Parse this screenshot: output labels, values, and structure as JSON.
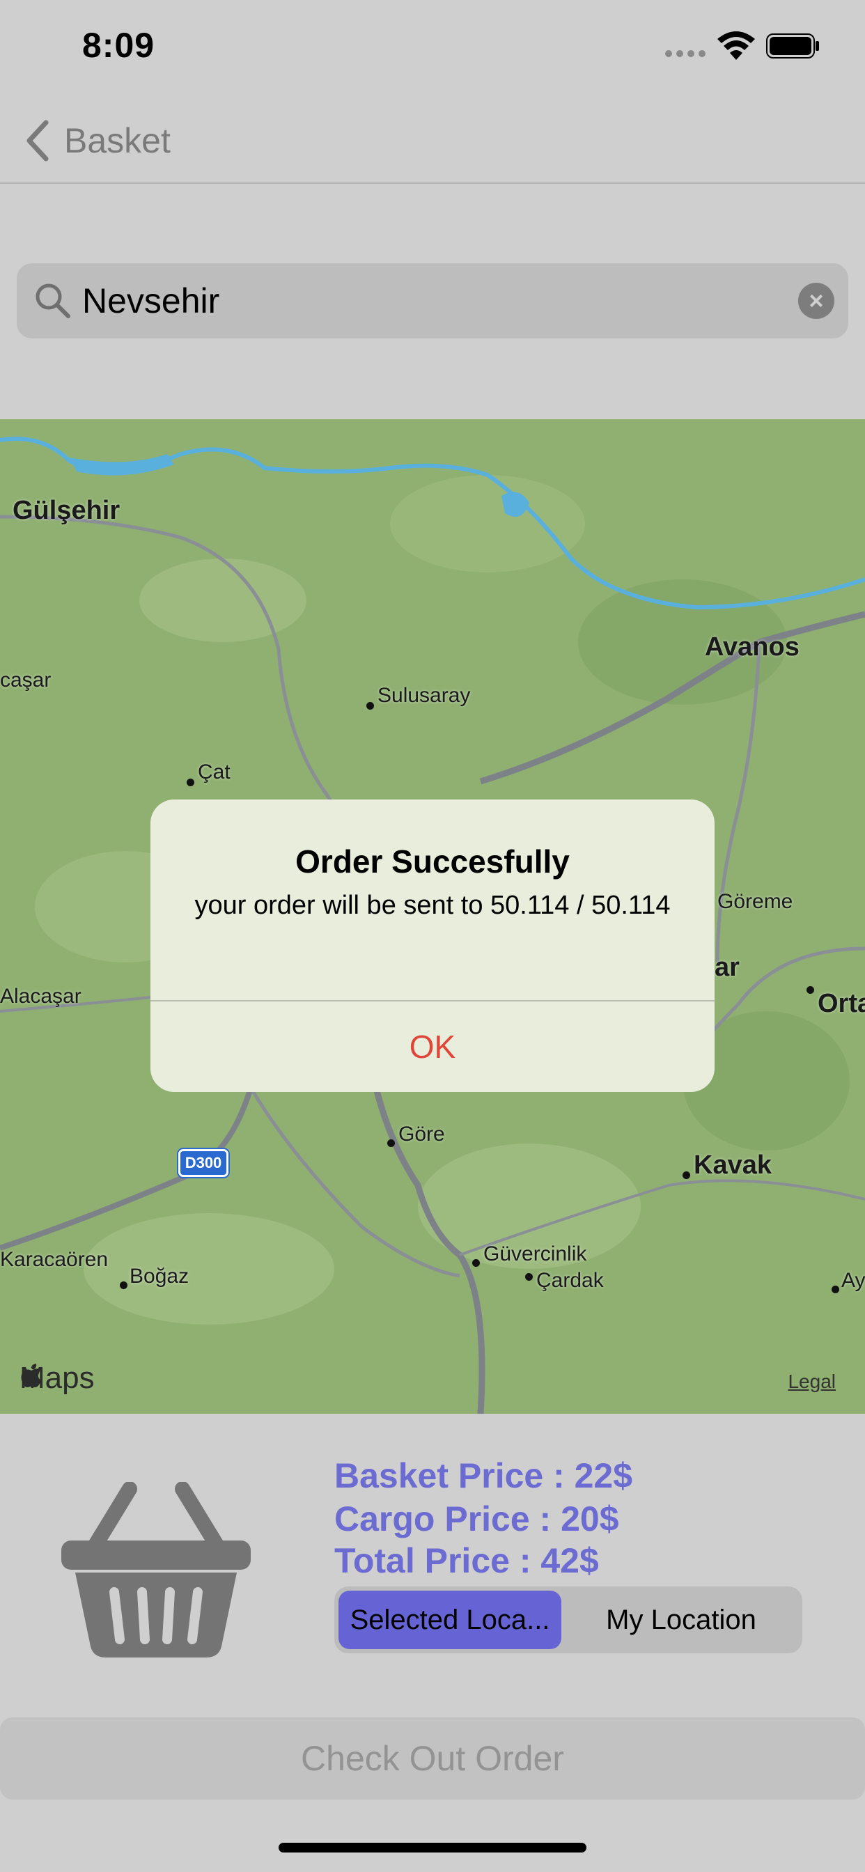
{
  "status_bar": {
    "time": "8:09"
  },
  "nav": {
    "back_label": "Basket"
  },
  "search": {
    "value": "Nevsehir"
  },
  "map": {
    "labels": {
      "gulsehir": "Gülşehir",
      "avanos": "Avanos",
      "acasar": "caşar",
      "sulusaray": "Sulusaray",
      "cat": "Çat",
      "goreme": "Göreme",
      "ar": "ar",
      "alacasar": "Alacaşar",
      "orta": "Orta",
      "gore": "Göre",
      "kavak": "Kavak",
      "karacaoren": "Karacaören",
      "bogaz": "Boğaz",
      "guvercinlik": "Güvercinlik",
      "cardak": "Çardak",
      "ay": "Ay"
    },
    "road_shield": "D300",
    "maps_logo": "Maps",
    "legal": "Legal"
  },
  "alert": {
    "title": "Order Succesfully",
    "message": "your order will be sent to 50.114 / 50.114",
    "ok_label": "OK"
  },
  "summary": {
    "basket_price": "Basket Price : 22$",
    "cargo_price": "Cargo Price : 20$",
    "total_price": "Total Price : 42$"
  },
  "location_segment": {
    "selected": "Selected Loca...",
    "other": "My Location"
  },
  "checkout": {
    "label": "Check Out Order"
  },
  "colors": {
    "accent": "#6b6bd2",
    "segment_selected": "#6664d4",
    "alert_ok": "#e0453a",
    "map_green": "#8fb070"
  }
}
